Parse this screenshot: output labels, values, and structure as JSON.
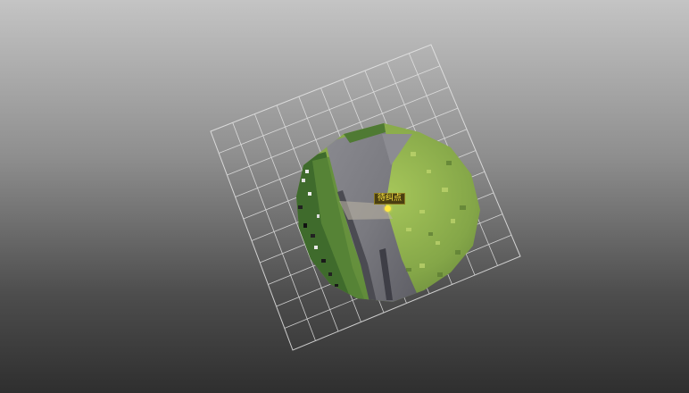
{
  "viewer": {
    "background_top": "#c4c4c4",
    "background_bottom": "#2f2f2f",
    "grid_color": "#e6e6e6"
  },
  "point_cloud": {
    "label_text": "待纠点",
    "marker_color": "#ffe840",
    "road_color": "#7c7c80",
    "grass_color": "#8cb04a",
    "vegetation_color": "#3e6a2a"
  }
}
